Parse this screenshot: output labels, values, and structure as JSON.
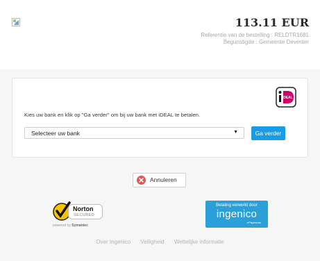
{
  "header": {
    "amount": "113.11 EUR",
    "reference_line": "Referentie van de bestelling : RELDTR1681",
    "beneficiary_line": "Begunstigde : Gemeente Deventer"
  },
  "payment": {
    "logo_icon": "ideal-logo-icon",
    "instruction": "Kies uw bank en klik op \"Ga verder\" om bij uw bank met iDEAL te betalen.",
    "bank_select_value": "Selecteer uw bank",
    "go_button_label": "Ga verder"
  },
  "cancel": {
    "label": "Annuleren",
    "icon": "close-icon"
  },
  "badges": {
    "norton_name": "Norton",
    "norton_secured": "SECURED",
    "norton_powered_prefix": "powered by ",
    "norton_powered_brand": "Symantec",
    "ingenico_top": "Betaling verwerkt door",
    "ingenico_name": "ingenico",
    "ingenico_sub": "ePayments"
  },
  "footer": {
    "links": [
      "Over Ingenico",
      "Veiligheid",
      "Wettelijke informatie"
    ]
  },
  "colors": {
    "accent_blue": "#1b9be5",
    "ideal_pink": "#cc0066",
    "cancel_red": "#e25555",
    "ingenico_blue": "#2ba0d8"
  }
}
